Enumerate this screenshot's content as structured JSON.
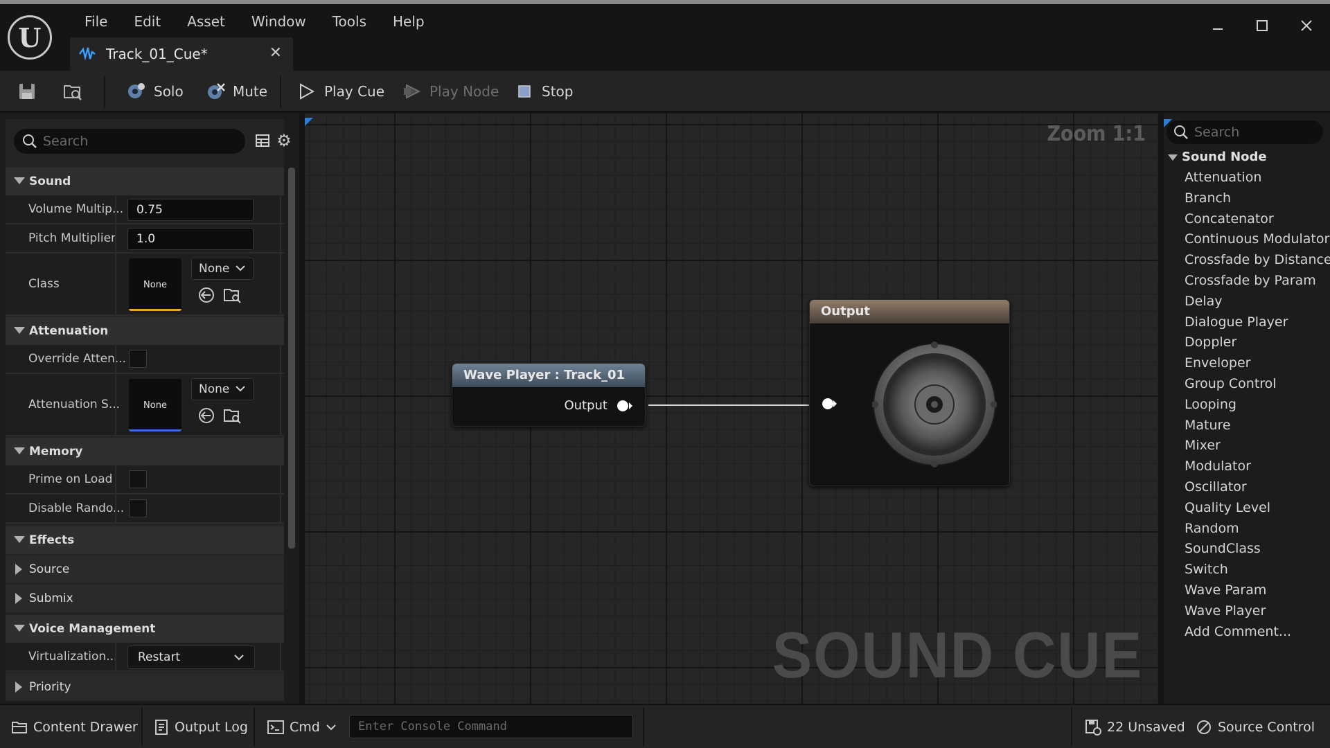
{
  "menu": [
    "File",
    "Edit",
    "Asset",
    "Window",
    "Tools",
    "Help"
  ],
  "tab": {
    "title": "Track_01_Cue*"
  },
  "toolbar": {
    "solo": "Solo",
    "mute": "Mute",
    "play_cue": "Play Cue",
    "play_node": "Play Node",
    "stop": "Stop"
  },
  "details": {
    "search_placeholder": "Search",
    "categories": {
      "sound": "Sound",
      "attenuation": "Attenuation",
      "memory": "Memory",
      "effects": "Effects",
      "voice_management": "Voice Management"
    },
    "props": {
      "volume_label": "Volume Multip...",
      "volume_value": "0.75",
      "pitch_label": "Pitch Multiplier",
      "pitch_value": "1.0",
      "class_label": "Class",
      "class_thumb": "None",
      "class_combo": "None",
      "override_atten_label": "Override Atten...",
      "atten_settings_label": "Attenuation S...",
      "atten_thumb": "None",
      "atten_combo": "None",
      "prime_label": "Prime on Load",
      "disable_random_label": "Disable Rando...",
      "source_label": "Source",
      "submix_label": "Submix",
      "virtualization_label": "Virtualization...",
      "virtualization_value": "Restart",
      "priority_label": "Priority"
    }
  },
  "graph": {
    "zoom": "Zoom 1:1",
    "watermark": "SOUND CUE",
    "wave_node_title": "Wave Player : Track_01",
    "wave_node_pin": "Output",
    "output_node_title": "Output"
  },
  "palette": {
    "search_placeholder": "Search",
    "category": "Sound Node",
    "items": [
      "Attenuation",
      "Branch",
      "Concatenator",
      "Continuous Modulator",
      "Crossfade by Distance",
      "Crossfade by Param",
      "Delay",
      "Dialogue Player",
      "Doppler",
      "Enveloper",
      "Group Control",
      "Looping",
      "Mature",
      "Mixer",
      "Modulator",
      "Oscillator",
      "Quality Level",
      "Random",
      "SoundClass",
      "Switch",
      "Wave Param",
      "Wave Player",
      "Add Comment..."
    ]
  },
  "statusbar": {
    "content_drawer": "Content Drawer",
    "output_log": "Output Log",
    "cmd": "Cmd",
    "console_placeholder": "Enter Console Command",
    "unsaved": "22 Unsaved",
    "source_control": "Source Control"
  },
  "colors": {
    "class_accent": "#f0a020",
    "attenuation_accent": "#3a6ae0",
    "corner_accent": "#2a7fd6"
  }
}
